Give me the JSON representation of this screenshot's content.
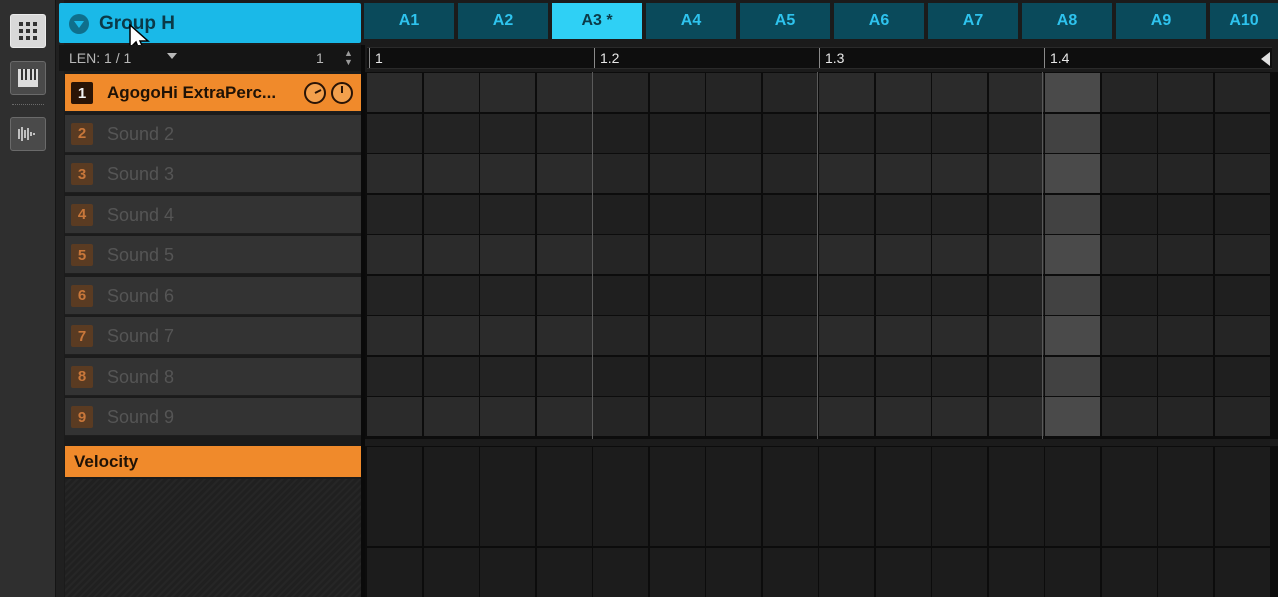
{
  "group": {
    "name": "Group H"
  },
  "tabs": [
    {
      "label": "A1",
      "selected": false
    },
    {
      "label": "A2",
      "selected": false
    },
    {
      "label": "A3 *",
      "selected": true
    },
    {
      "label": "A4",
      "selected": false
    },
    {
      "label": "A5",
      "selected": false
    },
    {
      "label": "A6",
      "selected": false
    },
    {
      "label": "A7",
      "selected": false
    },
    {
      "label": "A8",
      "selected": false
    },
    {
      "label": "A9",
      "selected": false
    },
    {
      "label": "A10",
      "selected": false
    }
  ],
  "len": {
    "label": "LEN: 1 / 1",
    "value": "1"
  },
  "ruler": [
    "1",
    "1.2",
    "1.3",
    "1.4"
  ],
  "sounds": [
    {
      "num": "1",
      "name": "AgogoHi ExtraPerc...",
      "selected": true
    },
    {
      "num": "2",
      "name": "Sound 2",
      "selected": false
    },
    {
      "num": "3",
      "name": "Sound 3",
      "selected": false
    },
    {
      "num": "4",
      "name": "Sound 4",
      "selected": false
    },
    {
      "num": "5",
      "name": "Sound 5",
      "selected": false
    },
    {
      "num": "6",
      "name": "Sound 6",
      "selected": false
    },
    {
      "num": "7",
      "name": "Sound 7",
      "selected": false
    },
    {
      "num": "8",
      "name": "Sound 8",
      "selected": false
    },
    {
      "num": "9",
      "name": "Sound 9",
      "selected": false
    }
  ],
  "velocity": {
    "label": "Velocity"
  },
  "colors": {
    "accent_orange": "#f08a2b",
    "accent_blue": "#1ab9e8",
    "playhead_column": 12
  }
}
